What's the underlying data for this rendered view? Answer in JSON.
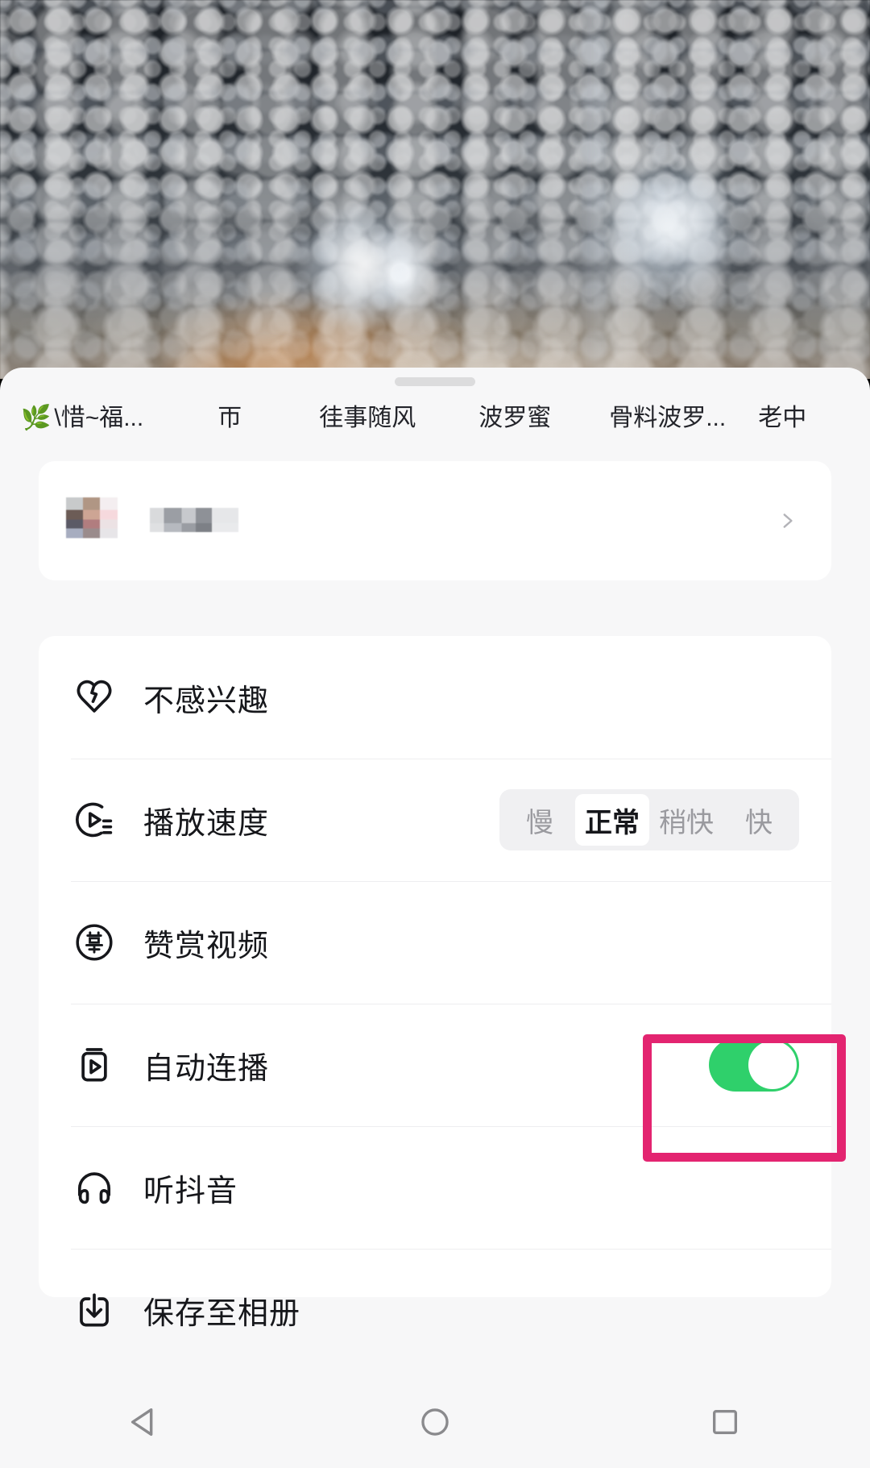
{
  "video": {
    "description": "night rain on windshield with bright lights and orange glow"
  },
  "sheet": {
    "handle": "drag-handle"
  },
  "tabs": [
    {
      "icon": "🌿",
      "label": "\\惜~福..."
    },
    {
      "icon": "",
      "label": "帀"
    },
    {
      "icon": "",
      "label": "徍事随风"
    },
    {
      "icon": "",
      "label": "波罗蜜"
    },
    {
      "icon": "",
      "label": "骨料波罗..."
    },
    {
      "icon": "",
      "label": "老中"
    }
  ],
  "profile": {
    "name": "",
    "chevron": "chevron-right-icon"
  },
  "menu": [
    {
      "icon": "broken-heart-icon",
      "label": "不感兴趣",
      "control": "none"
    },
    {
      "icon": "playback-speed-icon",
      "label": "播放速度",
      "control": "segmented"
    },
    {
      "icon": "reward-icon",
      "label": "赞赏视频",
      "control": "none"
    },
    {
      "icon": "auto-play-icon",
      "label": "自动连播",
      "control": "toggle"
    },
    {
      "icon": "headphones-icon",
      "label": "听抖音",
      "control": "none"
    },
    {
      "icon": "download-icon",
      "label": "保存至相册",
      "control": "none"
    }
  ],
  "speed_control": {
    "options": [
      "慢",
      "正常",
      "稍快",
      "快"
    ],
    "selected": "正常"
  },
  "auto_play_toggle": {
    "state": "on",
    "color_on": "#2fd06b",
    "knob_color": "#ffffff"
  },
  "highlight": {
    "color": "#e32470",
    "target": "auto-play-toggle"
  },
  "navbar": {
    "back": "back-triangle-icon",
    "home": "home-circle-icon",
    "recents": "recents-square-icon"
  },
  "colors": {
    "sheet_bg": "#f7f7f8",
    "card_bg": "#ffffff",
    "text": "#16171b",
    "muted": "#9a9a9f",
    "divider": "#eeeef0",
    "accent_green": "#2fd06b",
    "accent_pink": "#e32470"
  }
}
